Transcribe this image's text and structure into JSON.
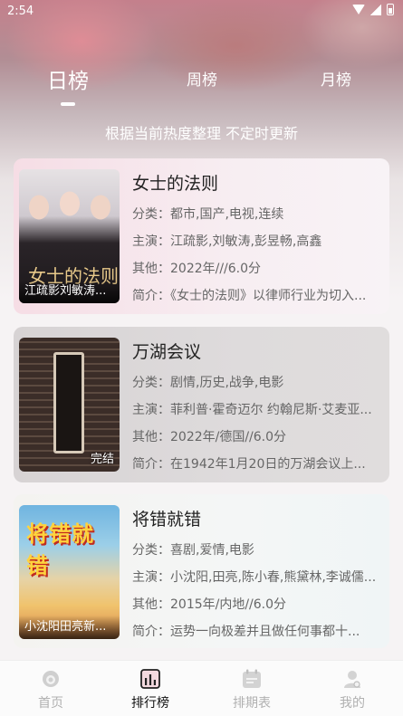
{
  "status_bar": {
    "time": "2:54"
  },
  "tabs": [
    {
      "label": "日榜",
      "active": true
    },
    {
      "label": "周榜",
      "active": false
    },
    {
      "label": "月榜",
      "active": false
    }
  ],
  "subtitle": "根据当前热度整理 不定时更新",
  "items": [
    {
      "title": "女士的法则",
      "poster_caption": "江疏影刘敏涛...",
      "poster_text": "女士的法则",
      "category": "分类：都市,国产,电视,连续",
      "cast": "主演：江疏影,刘敏涛,彭昱畅,高鑫",
      "other": "其他：2022年///6.0分",
      "intro": "简介：《女士的法则》以律师行业为切入..."
    },
    {
      "title": "万湖会议",
      "poster_caption": "完结",
      "category": "分类：剧情,历史,战争,电影",
      "cast": "主演：菲利普·霍奇迈尔 约翰尼斯·艾麦亚...",
      "other": "其他：2022年/德国//6.0分",
      "intro": "简介：在1942年1月20日的万湖会议上..."
    },
    {
      "title": "将错就错",
      "poster_caption": "小沈阳田亮新...",
      "poster_text": "将错就错",
      "category": "分类：喜剧,爱情,电影",
      "cast": "主演：小沈阳,田亮,陈小春,熊黛林,李诚儒...",
      "other": "其他：2015年/内地//6.0分",
      "intro": "简介：运势一向极差并且做任何事都十..."
    }
  ],
  "bottom_nav": [
    {
      "label": "首页",
      "icon": "home-icon",
      "active": false
    },
    {
      "label": "排行榜",
      "icon": "ranking-icon",
      "active": true
    },
    {
      "label": "排期表",
      "icon": "calendar-icon",
      "active": false
    },
    {
      "label": "我的",
      "icon": "profile-icon",
      "active": false
    }
  ],
  "colors": {
    "active": "#111111",
    "inactive": "#b0b0b0",
    "text": "#222222",
    "muted": "#666666"
  }
}
